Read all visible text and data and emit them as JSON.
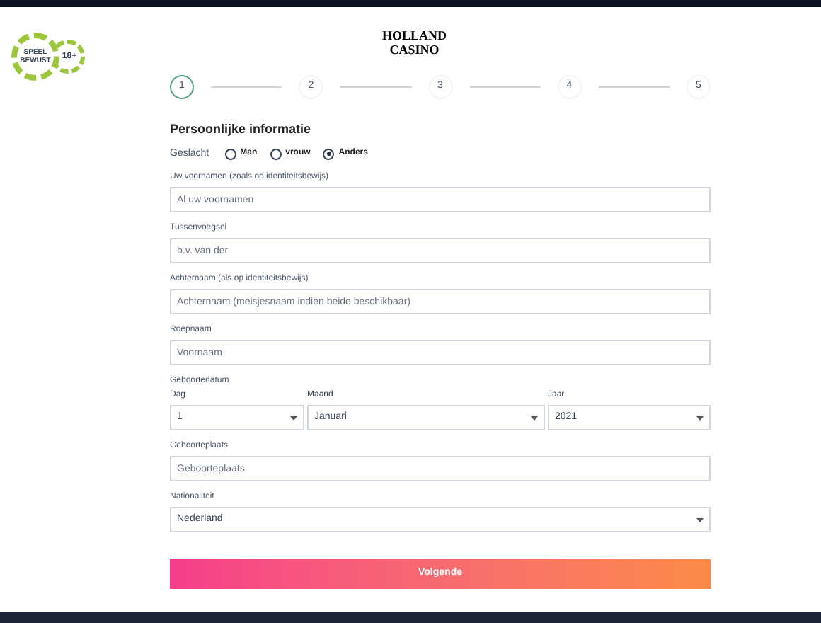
{
  "badge": {
    "line_1": "SPEEL",
    "line_2": "BEWUST",
    "age": "18+"
  },
  "logo": {
    "line_1": "HOLLAND",
    "line_2": "CASINO"
  },
  "steps": [
    {
      "label": "1",
      "selected": true
    },
    {
      "label": "2",
      "selected": false
    },
    {
      "label": "3",
      "selected": false
    },
    {
      "label": "4",
      "selected": false
    },
    {
      "label": "5",
      "selected": false
    }
  ],
  "heading": "Persoonlijke informatie",
  "gender": {
    "label": "Geslacht",
    "options": [
      {
        "label": "Man",
        "selected": false
      },
      {
        "label": "vrouw",
        "selected": false
      },
      {
        "label": "Anders",
        "selected": true
      }
    ]
  },
  "fields_top": [
    {
      "label": "Uw voornamen (zoals op identiteitsbewijs)",
      "placeholder": "Al uw voornamen"
    },
    {
      "label": "Tussenvoegsel",
      "placeholder": "b.v. van der"
    },
    {
      "label": "Achternaam (als op identiteitsbewijs)",
      "placeholder": "Achternaam (meisjesnaam indien beide beschikbaar)"
    },
    {
      "label": "Roepnaam",
      "placeholder": "Voornaam"
    }
  ],
  "birthdate": {
    "label": "Geboortedatum",
    "selects": [
      {
        "label": "Dag",
        "value": "1"
      },
      {
        "label": "Maand",
        "value": "Januari"
      },
      {
        "label": "Jaar",
        "value": "2021"
      }
    ]
  },
  "birthplace": {
    "label": "Geboorteplaats",
    "placeholder": "Geboorteplaats"
  },
  "nationality": {
    "label": "Nationaliteit",
    "value": "Nederland"
  },
  "submit": "Volgende"
}
